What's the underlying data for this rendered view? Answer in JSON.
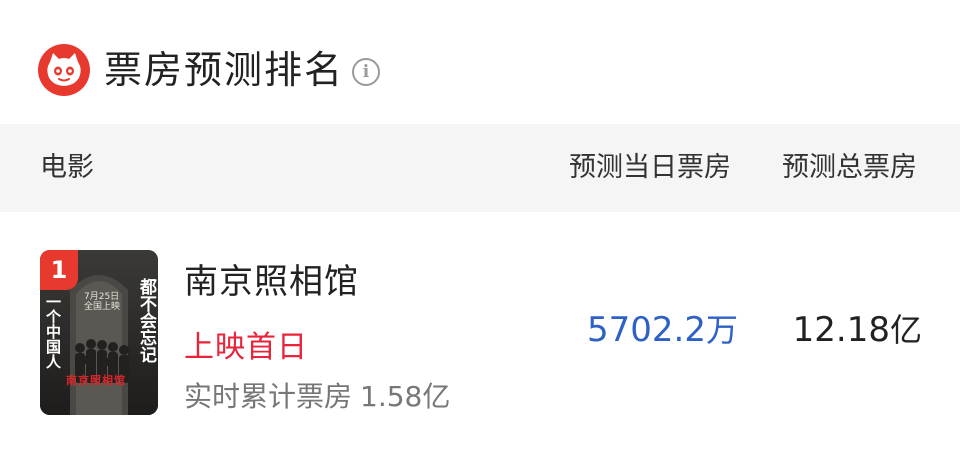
{
  "header": {
    "title": "票房预测排名",
    "logo_icon": "maoyan-cat-logo-icon",
    "info_icon": "info-icon",
    "info_glyph": "i"
  },
  "table": {
    "columns": {
      "movie": "电影",
      "predicted_day": "预测当日票房",
      "predicted_total": "预测总票房"
    }
  },
  "rows": [
    {
      "rank": "1",
      "title": "南京照相馆",
      "release_status": "上映首日",
      "cumulative_label": "实时累计票房",
      "cumulative_value": "1.58亿",
      "predicted_day_value": "5702.2",
      "predicted_day_unit": "万",
      "predicted_total_value": "12.18",
      "predicted_total_unit": "亿",
      "poster": {
        "side_text_left": "一个中国人",
        "side_text_right": "都不会忘记",
        "date_text": "7月25日",
        "date_sub": "全国上映",
        "logo_text": "南京照相馆"
      }
    }
  ],
  "colors": {
    "brand_red": "#e8392e",
    "release_red": "#e8233a",
    "day_value_blue": "#2e61c6",
    "header_bg": "#f5f5f5"
  }
}
